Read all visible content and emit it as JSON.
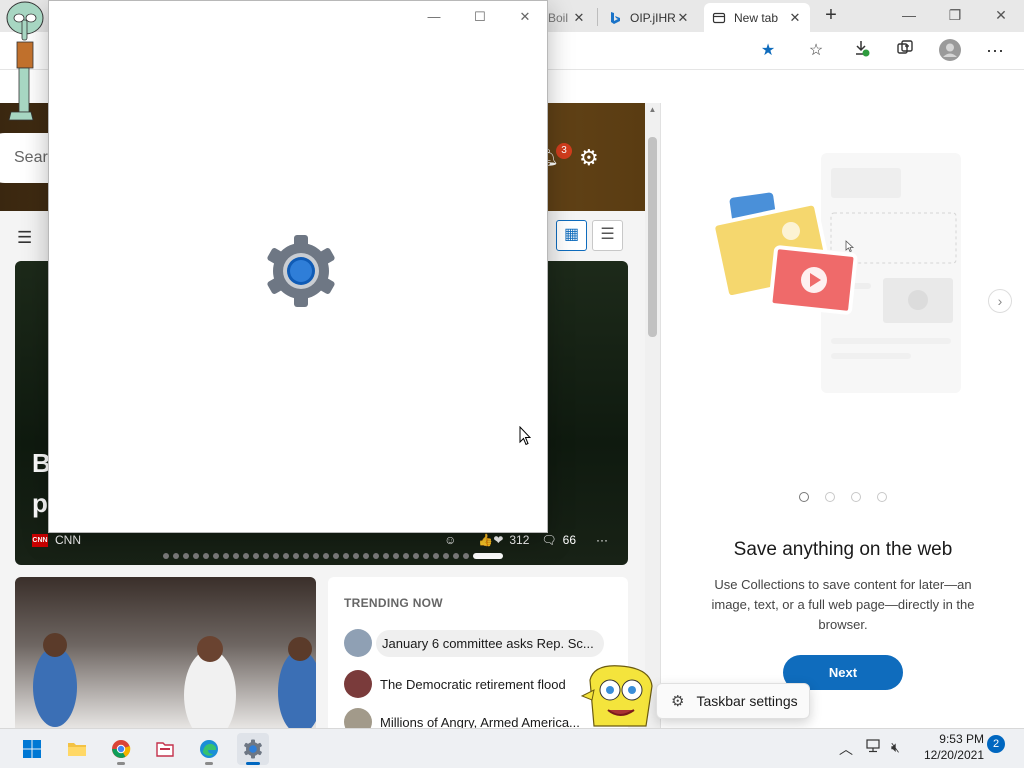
{
  "browser": {
    "tabs": [
      {
        "label": "Boil",
        "icon": "page-icon"
      },
      {
        "label": "OIP.jIHR",
        "icon": "bing-icon"
      },
      {
        "label": "New tab",
        "icon": "new-tab-icon"
      }
    ],
    "new_tab_symbol": "+",
    "close_symbol": "✕"
  },
  "ntp": {
    "search_placeholder": "Sear",
    "notification_count": "3",
    "hero": {
      "title_partial": "B p",
      "source": "CNN",
      "reactions": "312",
      "comments": "66",
      "more": "···"
    },
    "trending": {
      "heading": "TRENDING NOW",
      "items": [
        "January 6 committee asks Rep. Sc...",
        "The Democratic retirement flood",
        "Millions of Angry, Armed America..."
      ]
    }
  },
  "collections": {
    "title": "Save anything on the web",
    "description": "Use Collections to save content for later—an image, text, or a full web page—directly in the browser.",
    "next_button": "Next",
    "page_count": 4,
    "current_page": 1
  },
  "flyout": {
    "label": "Taskbar settings"
  },
  "taskbar": {
    "time": "9:53 PM",
    "date": "12/20/2021",
    "notification_count": "2",
    "apps": [
      "start",
      "file-explorer",
      "chrome",
      "file-manager",
      "edge",
      "settings"
    ],
    "active_app": "settings"
  },
  "colors": {
    "accent": "#0f6cbd",
    "taskbar_accent": "#0067c0",
    "badge_red": "#d13d1d"
  }
}
